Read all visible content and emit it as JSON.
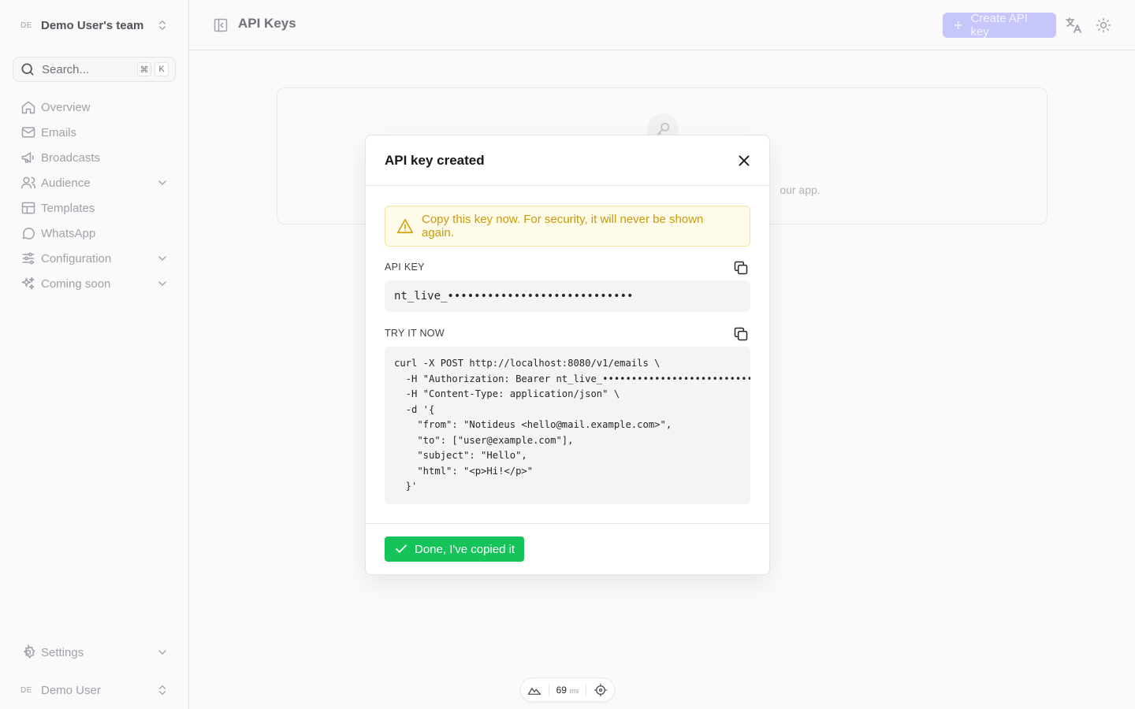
{
  "sidebar": {
    "team": {
      "avatar": "DE",
      "name": "Demo User's team"
    },
    "search": {
      "placeholder": "Search...",
      "kbd_1": "⌘",
      "kbd_2": "K"
    },
    "items": [
      {
        "label": "Overview",
        "icon": "home-icon",
        "expandable": false
      },
      {
        "label": "Emails",
        "icon": "mail-icon",
        "expandable": false
      },
      {
        "label": "Broadcasts",
        "icon": "megaphone-icon",
        "expandable": false
      },
      {
        "label": "Audience",
        "icon": "users-icon",
        "expandable": true
      },
      {
        "label": "Templates",
        "icon": "layout-icon",
        "expandable": false
      },
      {
        "label": "WhatsApp",
        "icon": "chat-icon",
        "expandable": false
      },
      {
        "label": "Configuration",
        "icon": "sliders-icon",
        "expandable": true
      },
      {
        "label": "Coming soon",
        "icon": "sparkles-icon",
        "expandable": true
      }
    ],
    "settings": {
      "label": "Settings",
      "icon": "gear-icon"
    },
    "user": {
      "avatar": "DE",
      "name": "Demo User"
    }
  },
  "header": {
    "title": "API Keys",
    "create_button": "Create API key"
  },
  "empty_state": {
    "text": "our app."
  },
  "modal": {
    "title": "API key created",
    "warning": "Copy this key now. For security, it will never be shown again.",
    "api_key_label": "API KEY",
    "api_key_value": "nt_live_••••••••••••••••••••••••••••",
    "try_label": "TRY IT NOW",
    "code": "curl -X POST http://localhost:8080/v1/emails \\\n  -H \"Authorization: Bearer nt_live_•••••••••••••••••••••••••••••\" \\\n  -H \"Content-Type: application/json\" \\\n  -d '{\n    \"from\": \"Notideus <hello@mail.example.com>\",\n    \"to\": [\"user@example.com\"],\n    \"subject\": \"Hello\",\n    \"html\": \"<p>Hi!</p>\"\n  }'",
    "done_button": "Done, I've copied it"
  },
  "devbar": {
    "ms_value": "69",
    "ms_unit": "ms"
  },
  "colors": {
    "accent": "#c7c6fb",
    "success": "#14c45a",
    "warning_bg": "#fefbe8",
    "warning_text": "#ca9a0c"
  }
}
